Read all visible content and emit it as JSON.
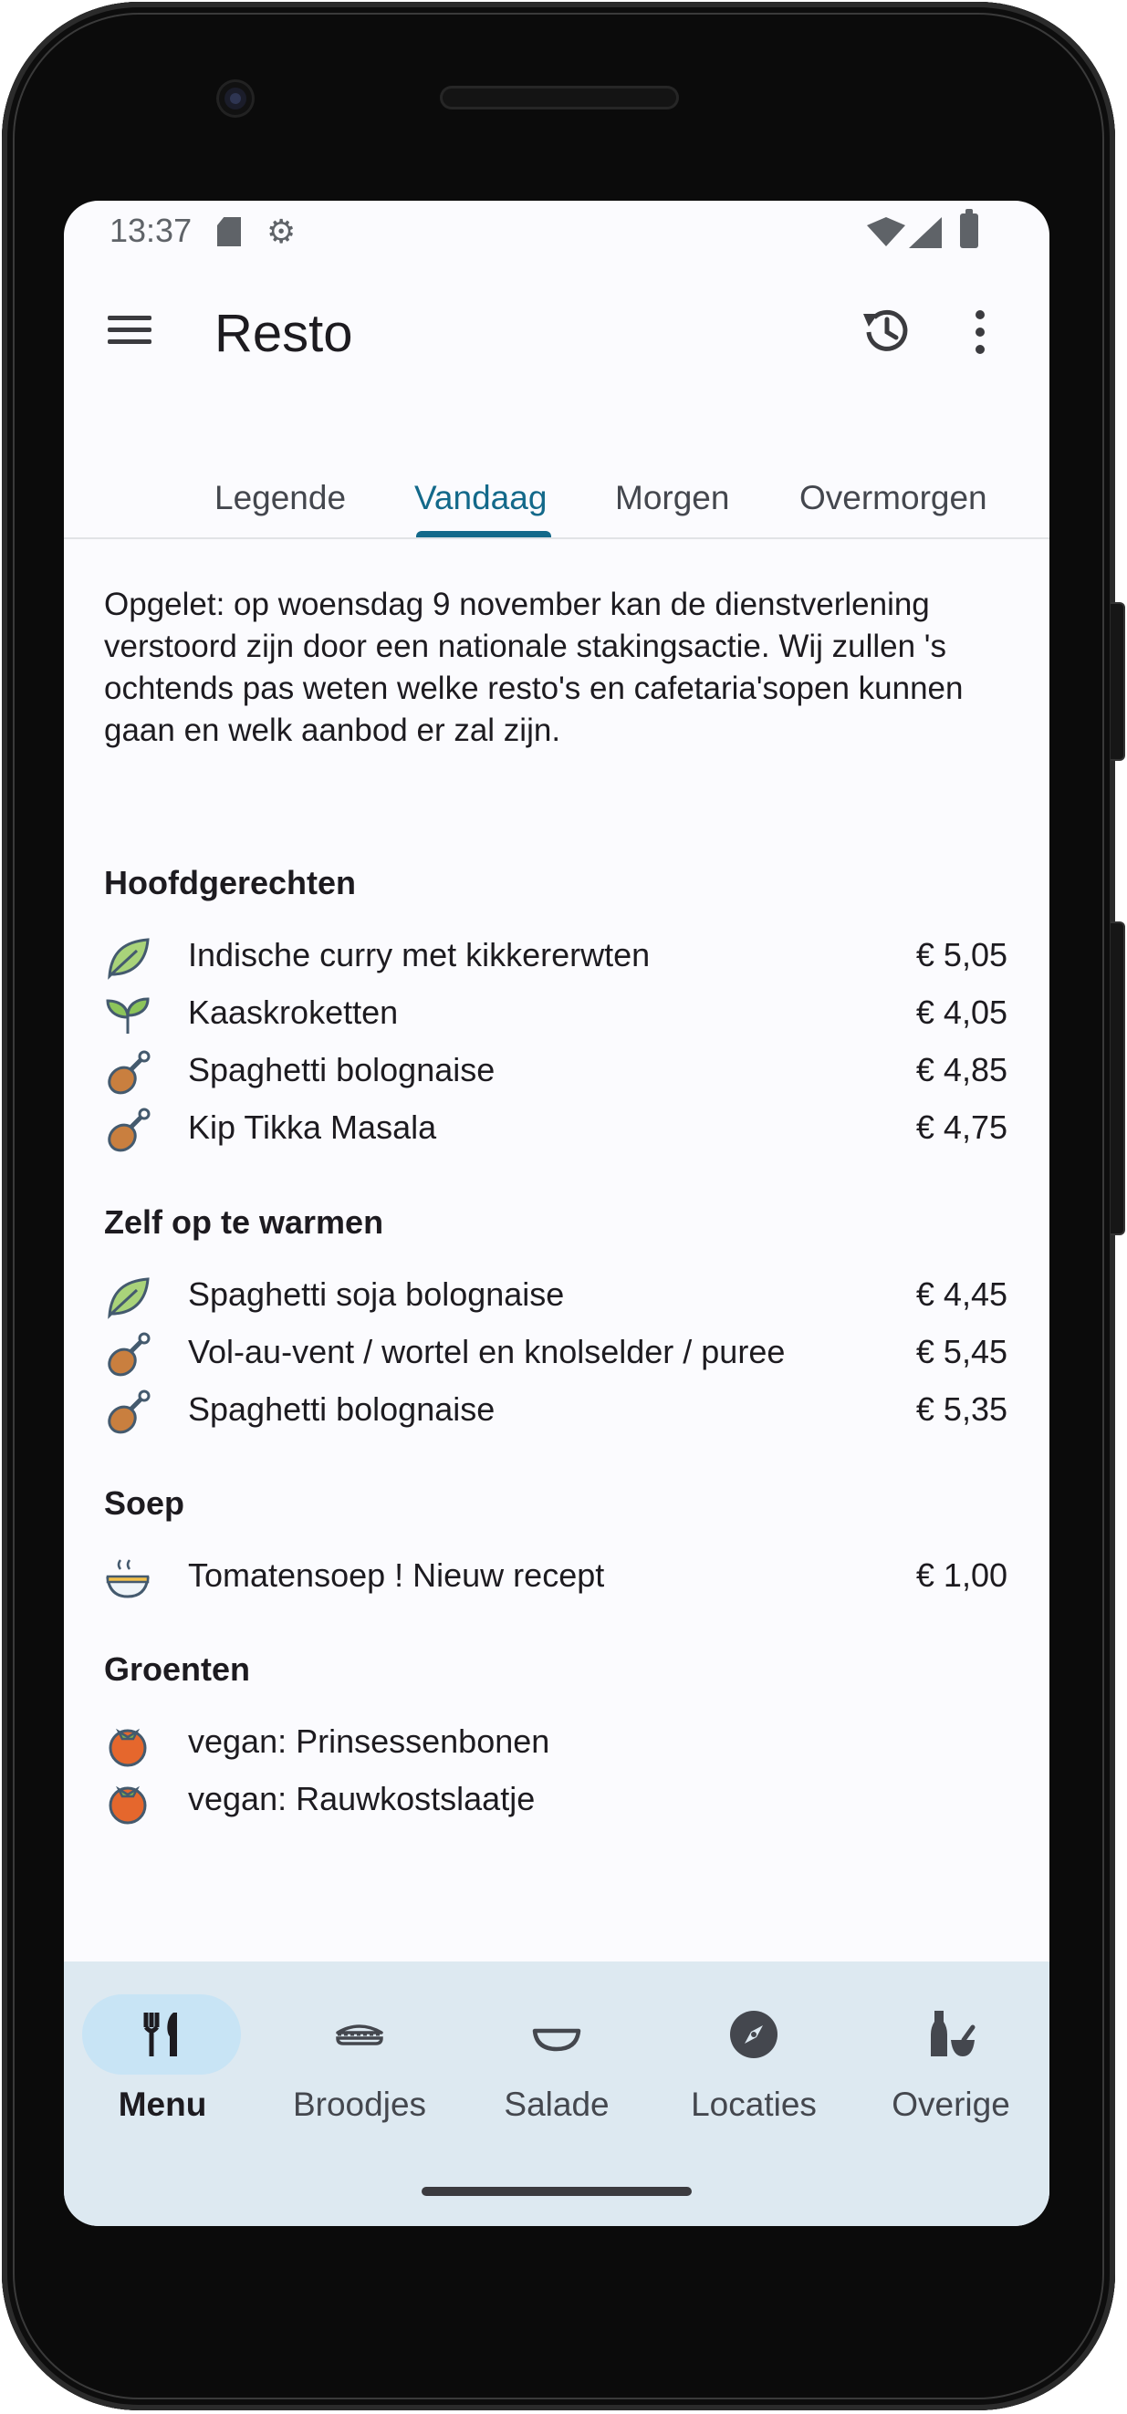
{
  "status_bar": {
    "time": "13:37",
    "icons": [
      "sd-card-icon",
      "settings-gear-icon",
      "wifi-icon",
      "cell-signal-icon",
      "battery-icon"
    ]
  },
  "app_bar": {
    "title": "Resto",
    "actions": [
      "history-icon",
      "more-vert-icon"
    ]
  },
  "tabs": [
    {
      "label": "Legende",
      "active": false
    },
    {
      "label": "Vandaag",
      "active": true
    },
    {
      "label": "Morgen",
      "active": false
    },
    {
      "label": "Overmorgen",
      "active": false
    }
  ],
  "notice": "Opgelet: op woensdag 9 november kan de dienstverlening verstoord zijn door een nationale stakingsactie. Wij zullen 's ochtends pas weten welke resto's en cafetaria'sopen kunnen gaan en welk aanbod er zal zijn.",
  "sections": [
    {
      "title": "Hoofdgerechten",
      "items": [
        {
          "icon": "leaf-icon",
          "name": "Indische curry met kikkererwten",
          "price": "€ 5,05"
        },
        {
          "icon": "sprout-icon",
          "name": "Kaaskroketten",
          "price": "€ 4,05"
        },
        {
          "icon": "drumstick-icon",
          "name": "Spaghetti bolognaise",
          "price": "€ 4,85"
        },
        {
          "icon": "drumstick-icon",
          "name": "Kip Tikka Masala",
          "price": "€ 4,75"
        }
      ]
    },
    {
      "title": "Zelf op te warmen",
      "items": [
        {
          "icon": "leaf-icon",
          "name": "Spaghetti soja bolognaise",
          "price": "€ 4,45"
        },
        {
          "icon": "drumstick-icon",
          "name": "Vol-au-vent / wortel en knolselder / puree",
          "price": "€ 5,45"
        },
        {
          "icon": "drumstick-icon",
          "name": "Spaghetti bolognaise",
          "price": "€ 5,35"
        }
      ]
    },
    {
      "title": "Soep",
      "items": [
        {
          "icon": "soup-bowl-icon",
          "name": "Tomatensoep ! Nieuw recept",
          "price": "€ 1,00"
        }
      ]
    },
    {
      "title": "Groenten",
      "items": [
        {
          "icon": "tomato-icon",
          "name": "vegan: Prinsessenbonen",
          "price": ""
        },
        {
          "icon": "tomato-icon",
          "name": "vegan: Rauwkostslaatje",
          "price": ""
        }
      ]
    }
  ],
  "bottom_nav": [
    {
      "label": "Menu",
      "icon": "fork-knife-icon",
      "active": true
    },
    {
      "label": "Broodjes",
      "icon": "sandwich-icon",
      "active": false
    },
    {
      "label": "Salade",
      "icon": "bowl-icon",
      "active": false
    },
    {
      "label": "Locaties",
      "icon": "compass-icon",
      "active": false
    },
    {
      "label": "Overige",
      "icon": "bottle-mortar-icon",
      "active": false
    }
  ],
  "colors": {
    "accent": "#13698a",
    "background": "#fbfbfe",
    "nav_background": "#dde9f1",
    "nav_active_pill": "#c8e4f5"
  }
}
